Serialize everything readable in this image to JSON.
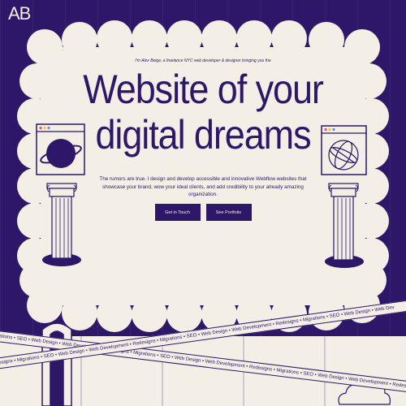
{
  "brand": {
    "logo_text": "AB"
  },
  "hero": {
    "intro": "I'm Alex Beige, a freelance NYC web developer & designer bringing you the",
    "headline_line1": "Website of your",
    "headline_line2": "digital dreams",
    "description": "The rumors are true. I design and develop accessible and innovative Webflow websites that showcase your brand, wow your ideal clients, and add credibility to your already amazing organization.",
    "primary_cta": "Get in Touch",
    "secondary_cta": "See Portfolio"
  },
  "banners": {
    "top": "• Migrations • SEO • Web Design • Web Development • Redesigns • Migrations • SEO • Web Design • Web Development • Redesigns • Migrations • SEO • Web Design • Web Development • Redesigns •",
    "bottom": "• Redesigns • Migrations • SEO • Web Design • Web Development • Redesigns • Migrations • SEO • Web Design • Web Development • Redesigns • Migrations • SEO • Web Design • Web Dev"
  },
  "colors": {
    "background": "#2c1769",
    "card": "#f3efe6",
    "accent_red": "#e4577a",
    "accent_yellow": "#f0c54a",
    "accent_blue": "#6a8fe0"
  },
  "icons": [
    "planet-icon",
    "globe-icon",
    "column-pedestal-icon",
    "cloud-icon",
    "arch-icon"
  ]
}
